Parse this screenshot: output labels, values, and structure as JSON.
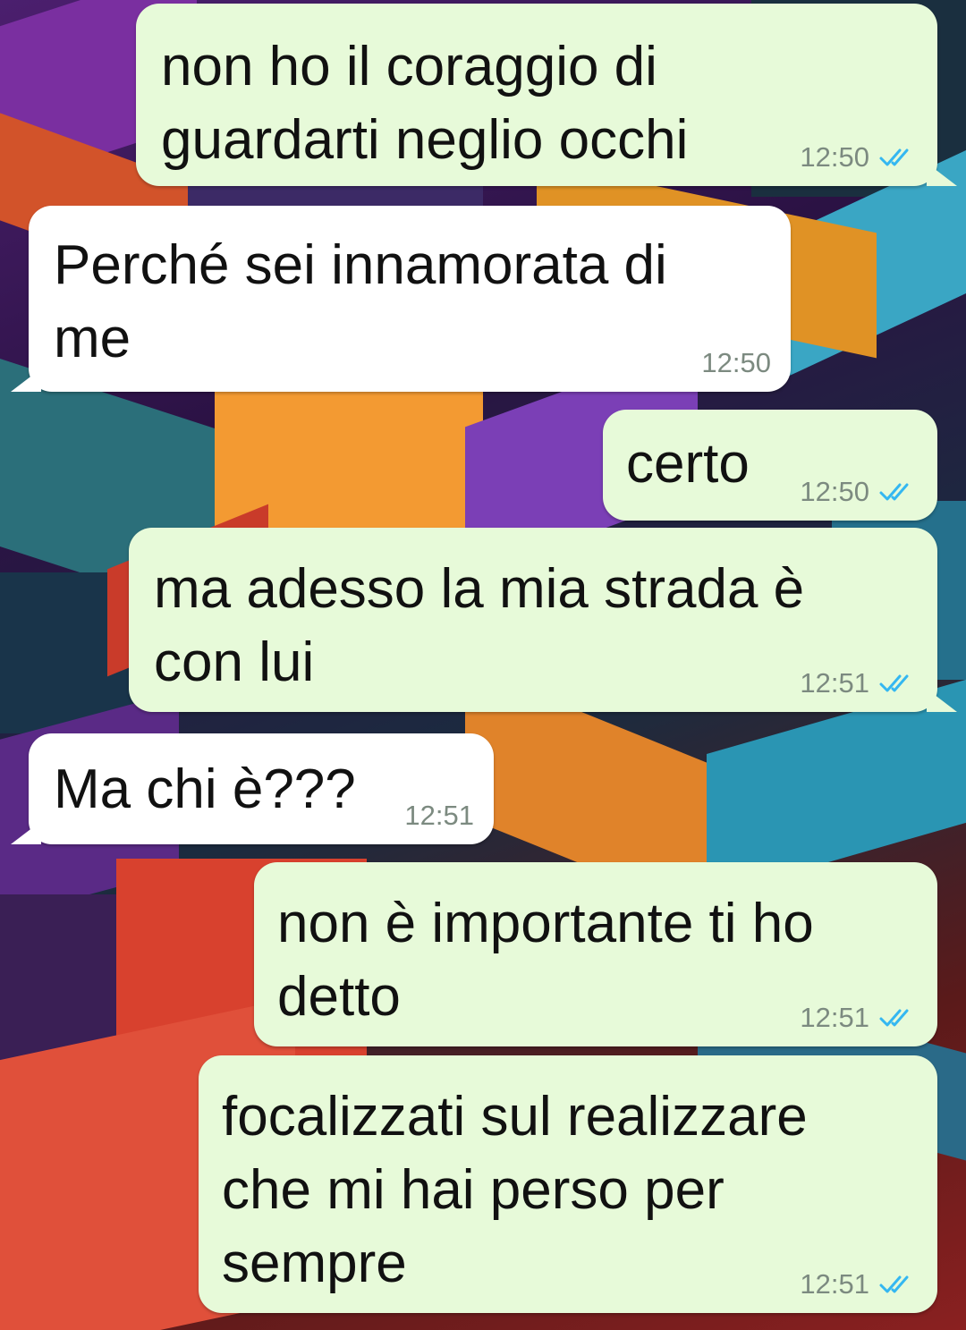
{
  "colors": {
    "outgoing_bubble": "#e7fad9",
    "incoming_bubble": "#ffffff",
    "read_ticks": "#34b7f1",
    "timestamp": "#7c8a80"
  },
  "messages": [
    {
      "direction": "outgoing",
      "text": "non ho il coraggio di\nguardarti neglio occhi",
      "time": "12:50",
      "status": "read-ticks-icon"
    },
    {
      "direction": "incoming",
      "text": "Perché sei innamorata di\nme",
      "time": "12:50"
    },
    {
      "direction": "outgoing",
      "text": "certo",
      "time": "12:50",
      "status": "read-ticks-icon"
    },
    {
      "direction": "outgoing",
      "text": "ma adesso la mia strada è\ncon lui",
      "time": "12:51",
      "status": "read-ticks-icon"
    },
    {
      "direction": "incoming",
      "text": "Ma chi è???",
      "time": "12:51"
    },
    {
      "direction": "outgoing",
      "text": "non è importante ti ho\ndetto",
      "time": "12:51",
      "status": "read-ticks-icon"
    },
    {
      "direction": "outgoing",
      "text": "focalizzati sul realizzare\nche mi hai perso per\nsempre",
      "time": "12:51",
      "status": "read-ticks-icon"
    }
  ]
}
